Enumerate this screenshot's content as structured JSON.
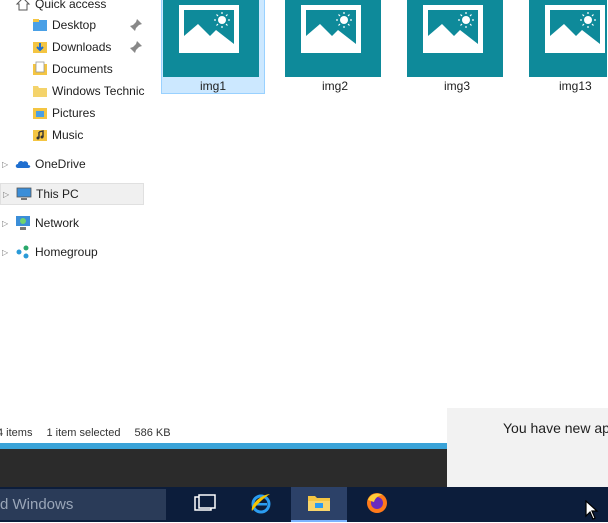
{
  "nav": {
    "quick_access": "Quick access",
    "desktop": "Desktop",
    "downloads": "Downloads",
    "documents": "Documents",
    "windows_technic": "Windows Technic",
    "pictures": "Pictures",
    "music": "Music",
    "onedrive": "OneDrive",
    "this_pc": "This PC",
    "network": "Network",
    "homegroup": "Homegroup"
  },
  "files": [
    {
      "name": "img1",
      "selected": true
    },
    {
      "name": "img2",
      "selected": false
    },
    {
      "name": "img3",
      "selected": false
    },
    {
      "name": "img13",
      "selected": false
    }
  ],
  "status": {
    "items": "4 items",
    "selected": "1 item selected",
    "size": "586 KB"
  },
  "notification": {
    "text": "You have new ap file."
  },
  "taskbar": {
    "search_text": "d Windows"
  },
  "colors": {
    "thumb_teal": "#0e8a9a",
    "selection": "#cce8ff",
    "taskbar": "#0c1d3b",
    "progress": "#3aa3d8"
  }
}
